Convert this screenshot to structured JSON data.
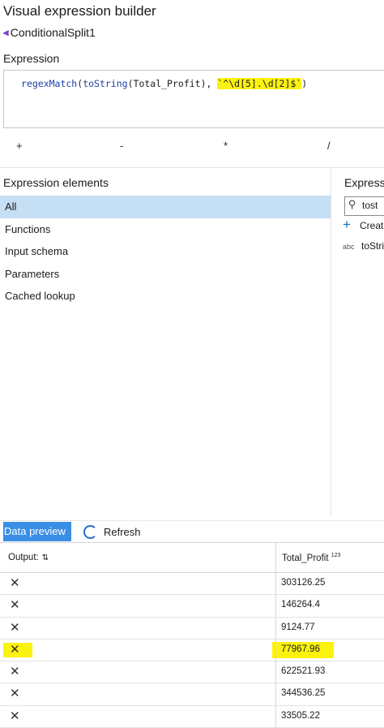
{
  "header": {
    "title": "Visual expression builder",
    "breadcrumb_icon": "conditional-split-icon",
    "breadcrumb": "ConditionalSplit1"
  },
  "expression": {
    "label": "Expression",
    "fn1": "regexMatch",
    "fn2": "toString",
    "arg": "Total_Profit",
    "pattern": "`^\\d[5].\\d[2]$`",
    "highlight_color": "#fbf20f"
  },
  "operators": [
    "+",
    "-",
    "*",
    "/"
  ],
  "elements_panel": {
    "title": "Expression elements",
    "items": [
      "All",
      "Functions",
      "Input schema",
      "Parameters",
      "Cached lookup"
    ],
    "selected_index": 0
  },
  "values_panel": {
    "title": "Expressi",
    "search_value": "tost",
    "create_label": "Create",
    "result_type": "abc",
    "result_label": "toStri"
  },
  "data_preview": {
    "tab_label": "Data preview",
    "refresh_label": "Refresh",
    "columns": {
      "output": "Output:",
      "profit": "Total_Profit",
      "profit_type": "123"
    },
    "rows": [
      {
        "output": "✕",
        "value": "303126.25",
        "highlighted": false
      },
      {
        "output": "✕",
        "value": "146264.4",
        "highlighted": false
      },
      {
        "output": "✕",
        "value": "9124.77",
        "highlighted": false
      },
      {
        "output": "✕",
        "value": "77967.96",
        "highlighted": true
      },
      {
        "output": "✕",
        "value": "622521.93",
        "highlighted": false
      },
      {
        "output": "✕",
        "value": "344536.25",
        "highlighted": false
      },
      {
        "output": "✕",
        "value": "33505.22",
        "highlighted": false
      }
    ]
  }
}
